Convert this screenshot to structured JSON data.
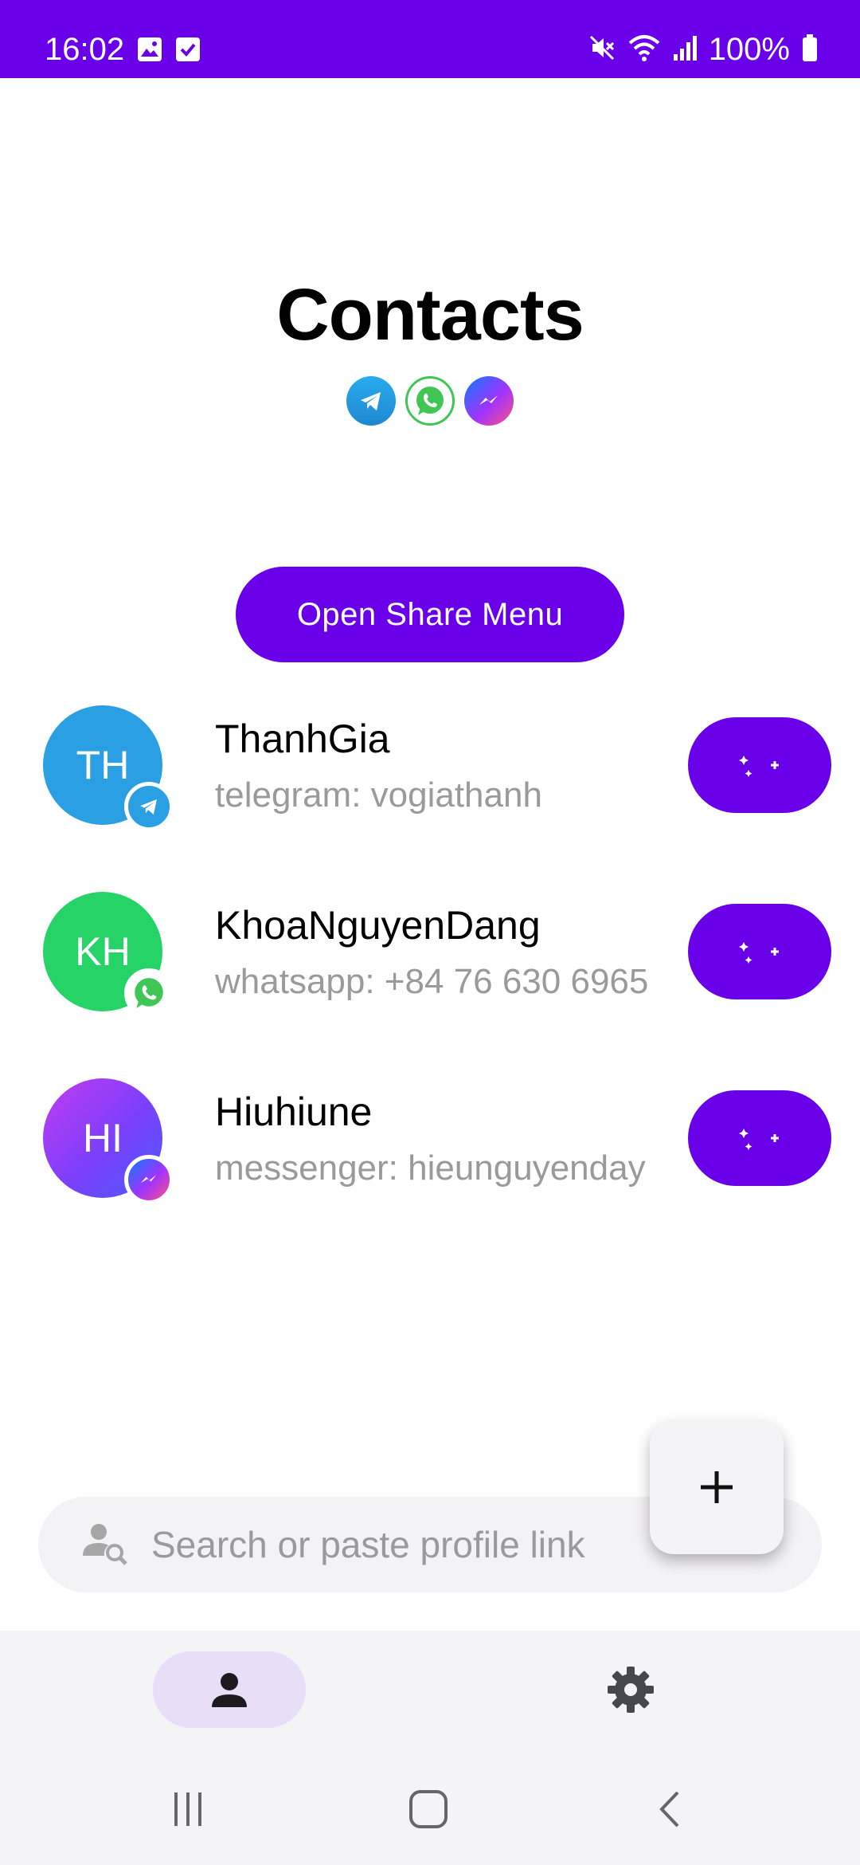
{
  "status_bar": {
    "time": "16:02",
    "battery_text": "100%",
    "icons": [
      "gallery-icon",
      "checkbox-icon",
      "mute-icon",
      "wifi-icon",
      "signal-icon",
      "battery-icon"
    ]
  },
  "header": {
    "title": "Contacts",
    "services": [
      "telegram-icon",
      "whatsapp-icon",
      "messenger-icon"
    ]
  },
  "share_button": {
    "label": "Open Share Menu"
  },
  "contacts": [
    {
      "initials": "TH",
      "name": "ThanhGia",
      "subtitle": "telegram: vogiathanh",
      "service": "telegram",
      "avatar_color": "#2b9fe3"
    },
    {
      "initials": "KH",
      "name": "KhoaNguyenDang",
      "subtitle": "whatsapp: +84 76 630 6965",
      "service": "whatsapp",
      "avatar_color": "#25d366"
    },
    {
      "initials": "HI",
      "name": "Hiuhiune",
      "subtitle": "messenger: hieunguyenday",
      "service": "messenger",
      "avatar_color": "#8a3ffc"
    }
  ],
  "search": {
    "placeholder": "Search or paste profile link",
    "value": ""
  },
  "fab": {
    "icon": "plus-icon"
  },
  "bottom_nav": {
    "items": [
      "person-icon",
      "gear-icon"
    ],
    "active": "person-icon"
  },
  "system_nav": [
    "recents-icon",
    "home-icon",
    "back-icon"
  ],
  "colors": {
    "accent": "#6a00ea",
    "nav_active_bg": "#e8def8",
    "subtitle": "#9a9a9a"
  }
}
